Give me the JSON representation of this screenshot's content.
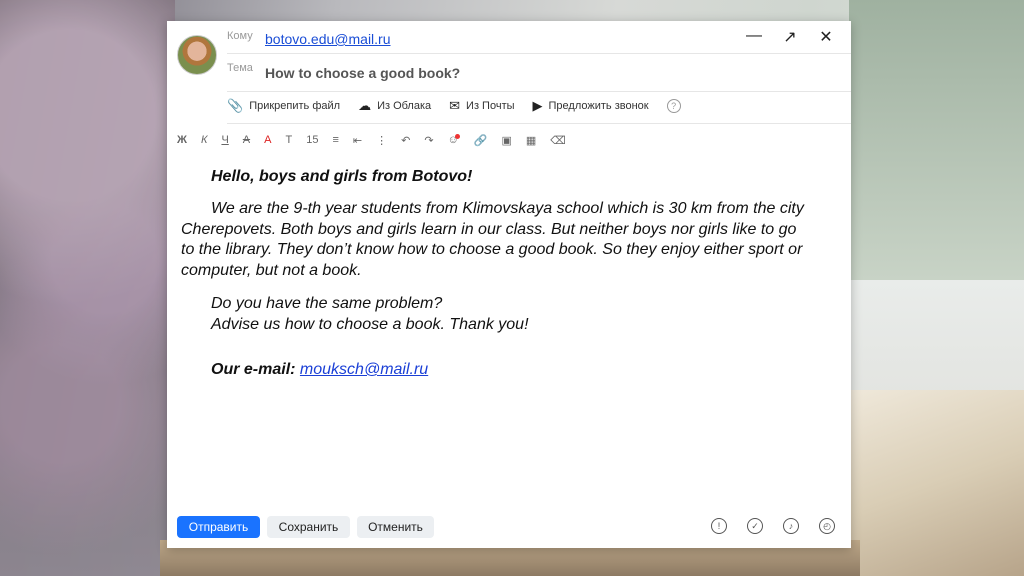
{
  "header": {
    "to_label": "Кому",
    "to_value": "botovo.edu@mail.ru",
    "subject_label": "Тема",
    "subject_value": "How to choose a good book?"
  },
  "attach_bar": {
    "attach_file": "Прикрепить файл",
    "from_cloud": "Из Облака",
    "from_mail": "Из Почты",
    "call_invite": "Предложить звонок"
  },
  "toolbar": {
    "bold": "Ж",
    "italic": "К",
    "underline": "Ч",
    "strike": "А",
    "font_color": "А",
    "font_style": "Т",
    "font_size": "15"
  },
  "body": {
    "greeting": "Hello, boys and girls from Botovo!",
    "paragraph1": "We are the 9-th year students from Klimovskaya school which is 30 km from the city Cherepovets. Both boys and girls learn in our class. But neither boys nor girls like to go to the library. They don’t know  how to choose a good book. So they enjoy either  sport or computer, but not a book.",
    "paragraph2_line1": "Do you have the same problem?",
    "paragraph2_line2": "Advise us how to choose a book. Thank you!",
    "email_label": "Our e-mail:",
    "email_value": "mouksch@mail.ru"
  },
  "footer": {
    "send": "Отправить",
    "save": "Сохранить",
    "cancel": "Отменить"
  }
}
